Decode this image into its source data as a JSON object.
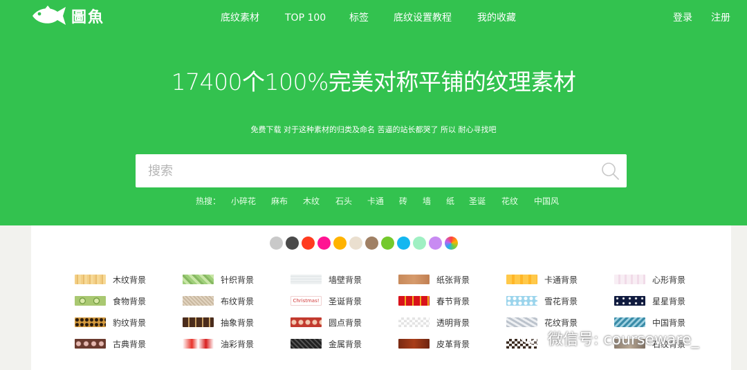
{
  "site": {
    "logo_text": "圖魚"
  },
  "nav": {
    "items": [
      "底纹素材",
      "TOP 100",
      "标签",
      "底纹设置教程",
      "我的收藏"
    ],
    "login": "登录",
    "register": "注册"
  },
  "hero": {
    "headline": "17400个100%完美对称平铺的纹理素材",
    "subline": "免费下载 对于这种素材的归类及命名 苦逼的站长都哭了 所以 耐心寻找吧"
  },
  "search": {
    "placeholder": "搜索"
  },
  "hot": {
    "label": "热搜：",
    "tags": [
      "小碎花",
      "麻布",
      "木纹",
      "石头",
      "卡通",
      "砖",
      "墙",
      "纸",
      "圣诞",
      "花纹",
      "中国风"
    ]
  },
  "colors": {
    "brand": "#33c24f",
    "swatches": [
      "#c9c9c9",
      "#4a4a4a",
      "#ff3b1f",
      "#ff1493",
      "#ffb300",
      "#eadfcf",
      "#a08064",
      "#74c92c",
      "#15b7f0",
      "#9ff0c3",
      "#c88bf2",
      "rainbow"
    ]
  },
  "categories": [
    {
      "label": "木纹背景",
      "thumb": "wood"
    },
    {
      "label": "针织背景",
      "thumb": "knit"
    },
    {
      "label": "墙壁背景",
      "thumb": "wall"
    },
    {
      "label": "纸张背景",
      "thumb": "paper"
    },
    {
      "label": "卡通背景",
      "thumb": "cartoon"
    },
    {
      "label": "心形背景",
      "thumb": "heart"
    },
    {
      "label": "食物背景",
      "thumb": "food"
    },
    {
      "label": "布纹背景",
      "thumb": "fabric"
    },
    {
      "label": "圣诞背景",
      "thumb": "christmas",
      "thumb_text": "Christmas!"
    },
    {
      "label": "春节背景",
      "thumb": "springfest"
    },
    {
      "label": "雪花背景",
      "thumb": "snow"
    },
    {
      "label": "星星背景",
      "thumb": "stars"
    },
    {
      "label": "豹纹背景",
      "thumb": "leopard"
    },
    {
      "label": "抽象背景",
      "thumb": "abstract"
    },
    {
      "label": "圆点背景",
      "thumb": "dots"
    },
    {
      "label": "透明背景",
      "thumb": "transparent"
    },
    {
      "label": "花纹背景",
      "thumb": "floral"
    },
    {
      "label": "中国背景",
      "thumb": "chinese"
    },
    {
      "label": "古典背景",
      "thumb": "classic"
    },
    {
      "label": "油彩背景",
      "thumb": "oil"
    },
    {
      "label": "金属背景",
      "thumb": "metal"
    },
    {
      "label": "皮革背景",
      "thumb": "leather"
    },
    {
      "label": "",
      "thumb": "misc"
    },
    {
      "label": "石纹背景",
      "thumb": "stone"
    }
  ],
  "watermark": {
    "text": "微信号: courseware_"
  }
}
